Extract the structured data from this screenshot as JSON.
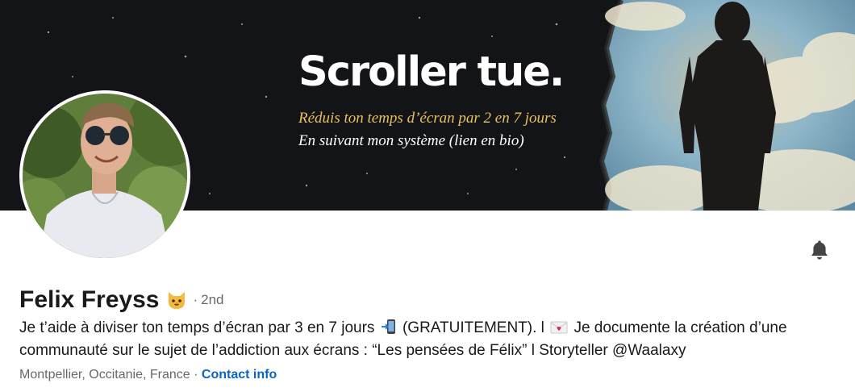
{
  "banner": {
    "headline": "Scroller tue.",
    "subline_1": "Réduis ton temps d’écran par 2 en 7 jours",
    "subline_2": "En suivant mon système (lien en bio)",
    "colors": {
      "background": "#121417",
      "accent": "#e8c35a",
      "sky": "#8fb6c8"
    }
  },
  "profile": {
    "name": "Felix Freyss",
    "name_emoji_icon": "cat-face-icon",
    "degree_separator": "·",
    "degree": "2nd",
    "headline_part_1": "Je t’aide à diviser ton temps d’écran par 3 en 7 jours",
    "headline_icon_1": "mobile-phone-arrow-icon",
    "headline_part_2": "(GRATUITEMENT). l",
    "headline_icon_2": "love-letter-icon",
    "headline_part_3": "Je documente la création d’une communauté sur le sujet de l’addiction aux écrans : “Les pensées de Félix” l Storyteller @Waalaxy",
    "location": "Montpellier, Occitanie, France",
    "location_separator": "·",
    "contact_label": "Contact info"
  },
  "actions": {
    "notification_icon": "bell-icon"
  },
  "colors": {
    "link": "#0a66c2",
    "text_primary": "#191919",
    "text_secondary": "#666666"
  }
}
